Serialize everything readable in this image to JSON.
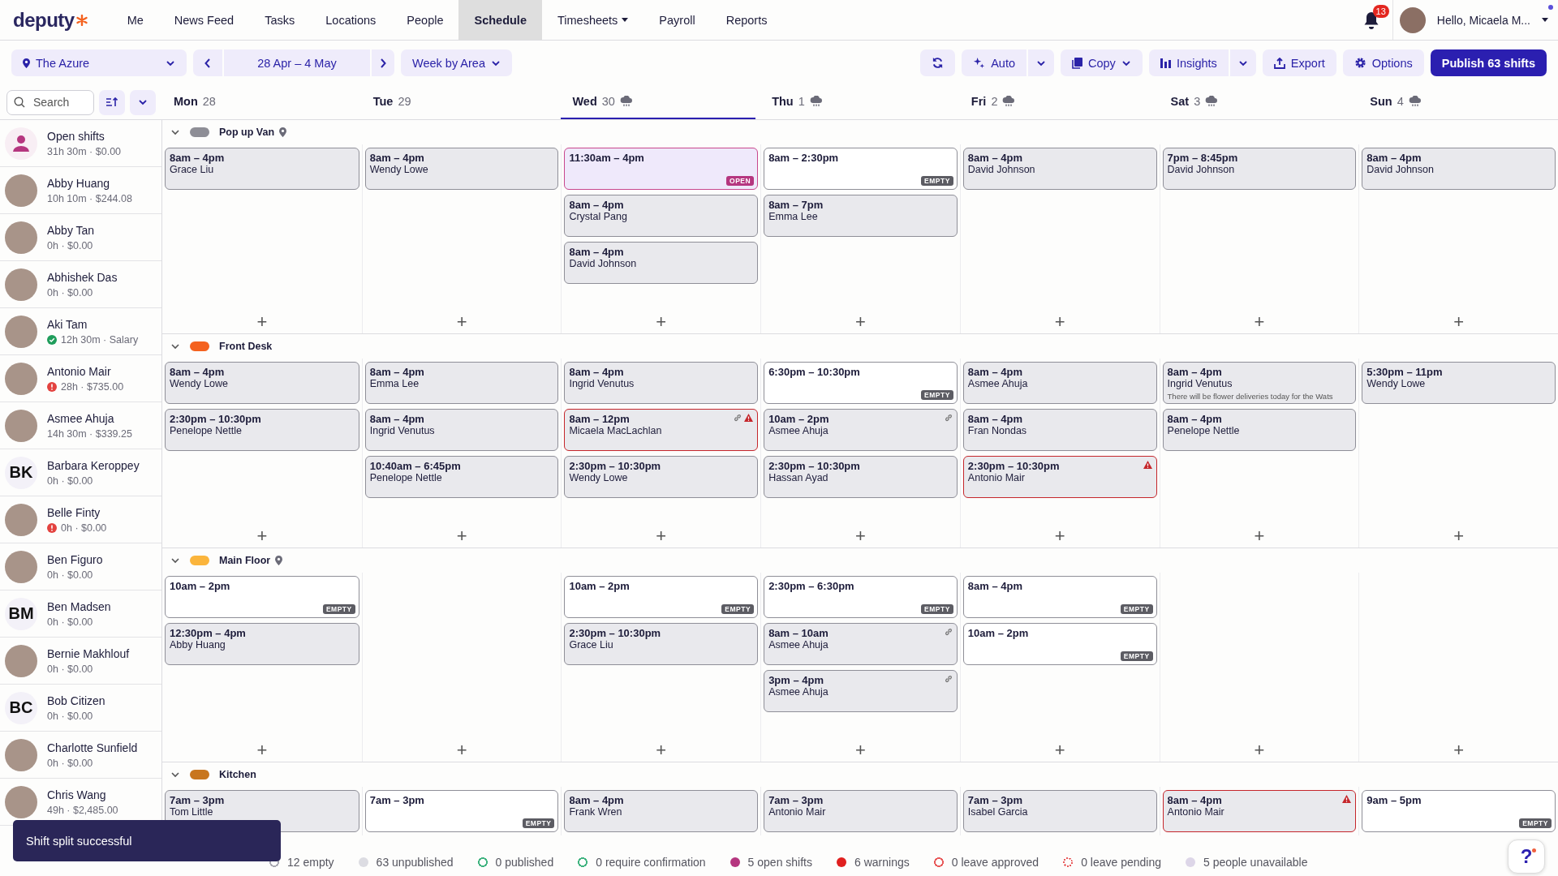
{
  "nav": {
    "logo": "deputy",
    "items": [
      {
        "label": "Me",
        "selected": false,
        "dropdown": false
      },
      {
        "label": "News Feed",
        "selected": false,
        "dropdown": false
      },
      {
        "label": "Tasks",
        "selected": false,
        "dropdown": false
      },
      {
        "label": "Locations",
        "selected": false,
        "dropdown": false
      },
      {
        "label": "People",
        "selected": false,
        "dropdown": false
      },
      {
        "label": "Schedule",
        "selected": true,
        "dropdown": false
      },
      {
        "label": "Timesheets",
        "selected": false,
        "dropdown": true
      },
      {
        "label": "Payroll",
        "selected": false,
        "dropdown": false
      },
      {
        "label": "Reports",
        "selected": false,
        "dropdown": false
      }
    ],
    "notifications": "13",
    "greeting": "Hello, Micaela M..."
  },
  "toolbar": {
    "location": "The Azure",
    "date_range": "28 Apr – 4 May",
    "view": "Week by Area",
    "actions": [
      {
        "kind": "icon"
      },
      {
        "label": "Auto",
        "kind": "split"
      },
      {
        "label": "Copy",
        "kind": "dropdown"
      },
      {
        "label": "Insights",
        "kind": "split"
      },
      {
        "label": "Export",
        "kind": "plain"
      },
      {
        "label": "Options",
        "kind": "plain"
      },
      {
        "label": "Publish 63 shifts",
        "kind": "primary"
      }
    ]
  },
  "search": {
    "placeholder": "Search"
  },
  "days": [
    {
      "day": "Mon",
      "date": "28",
      "selected": false,
      "weather": false
    },
    {
      "day": "Tue",
      "date": "29",
      "selected": false,
      "weather": false
    },
    {
      "day": "Wed",
      "date": "30",
      "selected": true,
      "weather": true
    },
    {
      "day": "Thu",
      "date": "1",
      "selected": false,
      "weather": true
    },
    {
      "day": "Fri",
      "date": "2",
      "selected": false,
      "weather": true
    },
    {
      "day": "Sat",
      "date": "3",
      "selected": false,
      "weather": true
    },
    {
      "day": "Sun",
      "date": "4",
      "selected": false,
      "weather": true
    }
  ],
  "people": [
    {
      "name": "Open shifts",
      "hours": "31h 30m · $0.00",
      "avatar": {
        "kind": "open"
      }
    },
    {
      "name": "Abby Huang",
      "hours": "10h 10m · $244.08",
      "avatar": {
        "kind": "photo"
      }
    },
    {
      "name": "Abby Tan",
      "hours": "0h · $0.00",
      "avatar": {
        "kind": "photo"
      }
    },
    {
      "name": "Abhishek Das",
      "hours": "0h · $0.00",
      "avatar": {
        "kind": "photo"
      }
    },
    {
      "name": "Aki Tam",
      "hours": "12h 30m · Salary",
      "avatar": {
        "kind": "photo"
      },
      "status": {
        "kind": "ok"
      }
    },
    {
      "name": "Antonio Mair",
      "hours": "28h · $735.00",
      "avatar": {
        "kind": "photo"
      },
      "status": {
        "kind": "warning"
      }
    },
    {
      "name": "Asmee Ahuja",
      "hours": "14h 30m · $339.25",
      "avatar": {
        "kind": "photo"
      }
    },
    {
      "name": "Barbara Keroppey",
      "hours": "0h · $0.00",
      "avatar": {
        "kind": "initials",
        "initials": "BK"
      }
    },
    {
      "name": "Belle Finty",
      "hours": "0h · $0.00",
      "avatar": {
        "kind": "photo"
      },
      "status": {
        "kind": "warning"
      }
    },
    {
      "name": "Ben Figuro",
      "hours": "0h · $0.00",
      "avatar": {
        "kind": "photo"
      }
    },
    {
      "name": "Ben Madsen",
      "hours": "0h · $0.00",
      "avatar": {
        "kind": "initials",
        "initials": "BM"
      }
    },
    {
      "name": "Bernie Makhlouf",
      "hours": "0h · $0.00",
      "avatar": {
        "kind": "photo"
      }
    },
    {
      "name": "Bob Citizen",
      "hours": "0h · $0.00",
      "avatar": {
        "kind": "initials",
        "initials": "BC"
      }
    },
    {
      "name": "Charlotte Sunfield",
      "hours": "0h · $0.00",
      "avatar": {
        "kind": "photo"
      }
    },
    {
      "name": "Chris Wang",
      "hours": "49h · $2,485.00",
      "avatar": {
        "kind": "photo"
      }
    }
  ],
  "areas": [
    {
      "name": "Pop up Van",
      "color": "#8e8e96",
      "expanded": true,
      "pinned": true,
      "days": [
        {
          "add": "+",
          "shifts": [
            {
              "time": "8am – 4pm",
              "name": "Grace Liu",
              "kind": "assigned"
            }
          ]
        },
        {
          "add": "+",
          "shifts": [
            {
              "time": "8am – 4pm",
              "name": "Wendy Lowe",
              "kind": "assigned"
            }
          ]
        },
        {
          "add": "+",
          "shifts": [
            {
              "time": "11:30am – 4pm",
              "kind": "open",
              "badge": "OPEN"
            },
            {
              "time": "8am – 4pm",
              "name": "Crystal Pang",
              "kind": "assigned"
            },
            {
              "time": "8am – 4pm",
              "name": "David Johnson",
              "kind": "assigned"
            }
          ]
        },
        {
          "add": "+",
          "shifts": [
            {
              "time": "8am – 2:30pm",
              "kind": "empty",
              "badge": "EMPTY"
            },
            {
              "time": "8am – 7pm",
              "name": "Emma Lee",
              "kind": "assigned"
            }
          ]
        },
        {
          "add": "+",
          "shifts": [
            {
              "time": "8am – 4pm",
              "name": "David Johnson",
              "kind": "assigned"
            }
          ]
        },
        {
          "add": "+",
          "shifts": [
            {
              "time": "7pm – 8:45pm",
              "name": "David Johnson",
              "kind": "assigned"
            }
          ]
        },
        {
          "add": "+",
          "shifts": [
            {
              "time": "8am – 4pm",
              "name": "David Johnson",
              "kind": "assigned"
            }
          ]
        }
      ]
    },
    {
      "name": "Front Desk",
      "color": "#f4621f",
      "expanded": true,
      "pinned": false,
      "days": [
        {
          "add": "+",
          "shifts": [
            {
              "time": "8am – 4pm",
              "name": "Wendy Lowe",
              "kind": "assigned"
            },
            {
              "time": "2:30pm – 10:30pm",
              "name": "Penelope Nettle",
              "kind": "assigned"
            }
          ]
        },
        {
          "add": "+",
          "shifts": [
            {
              "time": "8am – 4pm",
              "name": "Emma Lee",
              "kind": "assigned"
            },
            {
              "time": "8am – 4pm",
              "name": "Ingrid Venutus",
              "kind": "assigned"
            },
            {
              "time": "10:40am – 6:45pm",
              "name": "Penelope Nettle",
              "kind": "assigned"
            }
          ]
        },
        {
          "add": "+",
          "shifts": [
            {
              "time": "8am – 4pm",
              "name": "Ingrid Venutus",
              "kind": "assigned"
            },
            {
              "time": "8am – 12pm",
              "name": "Micaela MacLachlan",
              "kind": "assigned",
              "linked": true,
              "warning": true
            },
            {
              "time": "2:30pm – 10:30pm",
              "name": "Wendy Lowe",
              "kind": "assigned"
            }
          ]
        },
        {
          "add": "+",
          "shifts": [
            {
              "time": "6:30pm – 10:30pm",
              "kind": "empty",
              "badge": "EMPTY"
            },
            {
              "time": "10am – 2pm",
              "name": "Asmee Ahuja",
              "kind": "assigned",
              "linked": true
            },
            {
              "time": "2:30pm – 10:30pm",
              "name": "Hassan Ayad",
              "kind": "assigned"
            }
          ]
        },
        {
          "add": "+",
          "shifts": [
            {
              "time": "8am – 4pm",
              "name": "Asmee Ahuja",
              "kind": "assigned"
            },
            {
              "time": "8am – 4pm",
              "name": "Fran Nondas",
              "kind": "assigned"
            },
            {
              "time": "2:30pm – 10:30pm",
              "name": "Antonio Mair",
              "kind": "assigned",
              "warning": true
            }
          ]
        },
        {
          "add": "+",
          "shifts": [
            {
              "time": "8am – 4pm",
              "name": "Ingrid Venutus",
              "note": "There will be flower deliveries today for the Wats",
              "kind": "assigned"
            },
            {
              "time": "8am – 4pm",
              "name": "Penelope Nettle",
              "kind": "assigned"
            }
          ]
        },
        {
          "add": "+",
          "shifts": [
            {
              "time": "5:30pm – 11pm",
              "name": "Wendy Lowe",
              "kind": "assigned"
            }
          ]
        }
      ]
    },
    {
      "name": "Main Floor",
      "color": "#fbb53c",
      "expanded": true,
      "pinned": true,
      "days": [
        {
          "add": "+",
          "shifts": [
            {
              "time": "10am – 2pm",
              "kind": "empty",
              "badge": "EMPTY"
            },
            {
              "time": "12:30pm – 4pm",
              "name": "Abby Huang",
              "kind": "assigned"
            }
          ]
        },
        {
          "add": "+"
        },
        {
          "add": "+",
          "shifts": [
            {
              "time": "10am – 2pm",
              "kind": "empty",
              "badge": "EMPTY"
            },
            {
              "time": "2:30pm – 10:30pm",
              "name": "Grace Liu",
              "kind": "assigned"
            }
          ]
        },
        {
          "add": "+",
          "shifts": [
            {
              "time": "2:30pm – 6:30pm",
              "kind": "empty",
              "badge": "EMPTY"
            },
            {
              "time": "8am – 10am",
              "name": "Asmee Ahuja",
              "kind": "assigned",
              "linked": true
            },
            {
              "time": "3pm – 4pm",
              "name": "Asmee Ahuja",
              "kind": "assigned",
              "linked": true
            }
          ]
        },
        {
          "add": "+",
          "shifts": [
            {
              "time": "8am – 4pm",
              "kind": "empty",
              "badge": "EMPTY"
            },
            {
              "time": "10am – 2pm",
              "kind": "empty",
              "badge": "EMPTY"
            }
          ]
        },
        {
          "add": "+"
        },
        {
          "add": "+"
        }
      ]
    },
    {
      "name": "Kitchen",
      "color": "#c8761e",
      "expanded": true,
      "pinned": false,
      "days": [
        {
          "shifts": [
            {
              "time": "7am – 3pm",
              "name": "Tom Little",
              "kind": "assigned"
            }
          ]
        },
        {
          "shifts": [
            {
              "time": "7am – 3pm",
              "kind": "empty",
              "badge": "EMPTY"
            }
          ]
        },
        {
          "shifts": [
            {
              "time": "8am – 4pm",
              "name": "Frank Wren",
              "kind": "assigned"
            }
          ]
        },
        {
          "shifts": [
            {
              "time": "7am – 3pm",
              "name": "Antonio Mair",
              "kind": "assigned"
            }
          ]
        },
        {
          "shifts": [
            {
              "time": "7am – 3pm",
              "name": "Isabel Garcia",
              "kind": "assigned"
            }
          ]
        },
        {
          "shifts": [
            {
              "time": "8am – 4pm",
              "name": "Antonio Mair",
              "kind": "assigned",
              "warning": true
            }
          ]
        },
        {
          "shifts": [
            {
              "time": "9am – 5pm",
              "kind": "empty",
              "badge": "EMPTY"
            }
          ]
        }
      ]
    }
  ],
  "legend": [
    {
      "label": "12 empty",
      "kind": "outline",
      "color": "#a9a9b2"
    },
    {
      "label": "63 unpublished",
      "kind": "filled",
      "color": "#dcdce2"
    },
    {
      "label": "0 published",
      "kind": "outline",
      "color": "#3fb37f"
    },
    {
      "label": "0 require confirmation",
      "kind": "outline",
      "color": "#3fb37f"
    },
    {
      "label": "5 open shifts",
      "kind": "filled",
      "color": "#b5367f"
    },
    {
      "label": "6 warnings",
      "kind": "filled",
      "color": "#e0201f"
    },
    {
      "label": "0 leave approved",
      "kind": "outline",
      "color": "#e85a5a"
    },
    {
      "label": "0 leave pending",
      "kind": "dashed",
      "color": "#e85a5a"
    },
    {
      "label": "5 people unavailable",
      "kind": "filled",
      "color": "#ddd6e8"
    }
  ],
  "toast": "Shift split successful",
  "help": "?"
}
